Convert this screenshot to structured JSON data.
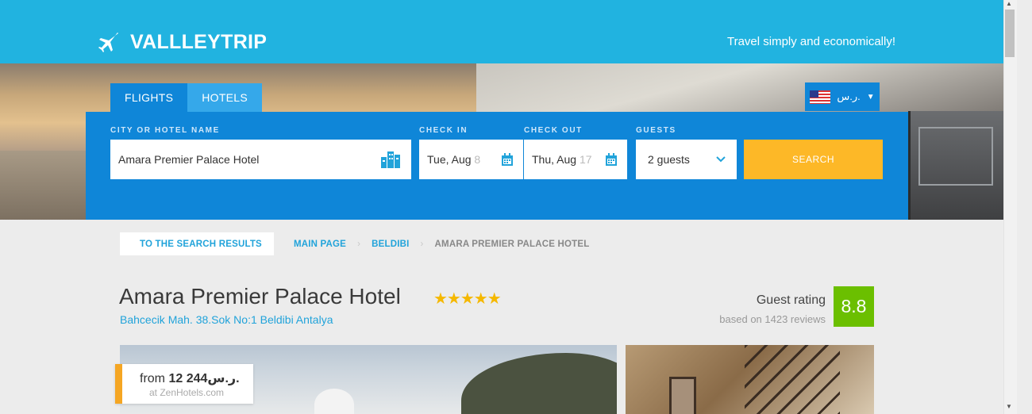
{
  "header": {
    "brand": "VALLLEYTRIP",
    "tagline": "Travel simply and economically!",
    "currency": "ر.س."
  },
  "search": {
    "tabs": [
      {
        "label": "FLIGHTS",
        "active": true
      },
      {
        "label": "HOTELS",
        "active": false
      }
    ],
    "labels": {
      "city": "CITY OR HOTEL NAME",
      "check_in": "CHECK IN",
      "check_out": "CHECK OUT",
      "guests": "GUESTS"
    },
    "city_value": "Amara Premier Palace Hotel",
    "check_in_value": "Tue, Aug",
    "check_in_day": "8",
    "check_out_value": "Thu, Aug",
    "check_out_day": "17",
    "guests_value": "2 guests",
    "button": "SEARCH"
  },
  "breadcrumbs": {
    "back": "TO THE SEARCH RESULTS",
    "items": [
      "MAIN PAGE",
      "BELDIBI",
      "AMARA PREMIER PALACE HOTEL"
    ]
  },
  "hotel": {
    "name": "Amara Premier Palace Hotel",
    "stars": "★★★★★",
    "address": "Bahcecik Mah. 38.Sok No:1 Beldibi Antalya",
    "rating_label": "Guest rating",
    "rating_sub": "based on 1423 reviews",
    "score": "8.8",
    "price_prefix": "from",
    "price_value": "12 244",
    "price_currency": "ر.س.",
    "price_source": "at ZenHotels.com"
  },
  "colors": {
    "header": "#21b3e0",
    "panel": "#0f86d8",
    "accent": "#fdb827",
    "score": "#6bbf00"
  }
}
